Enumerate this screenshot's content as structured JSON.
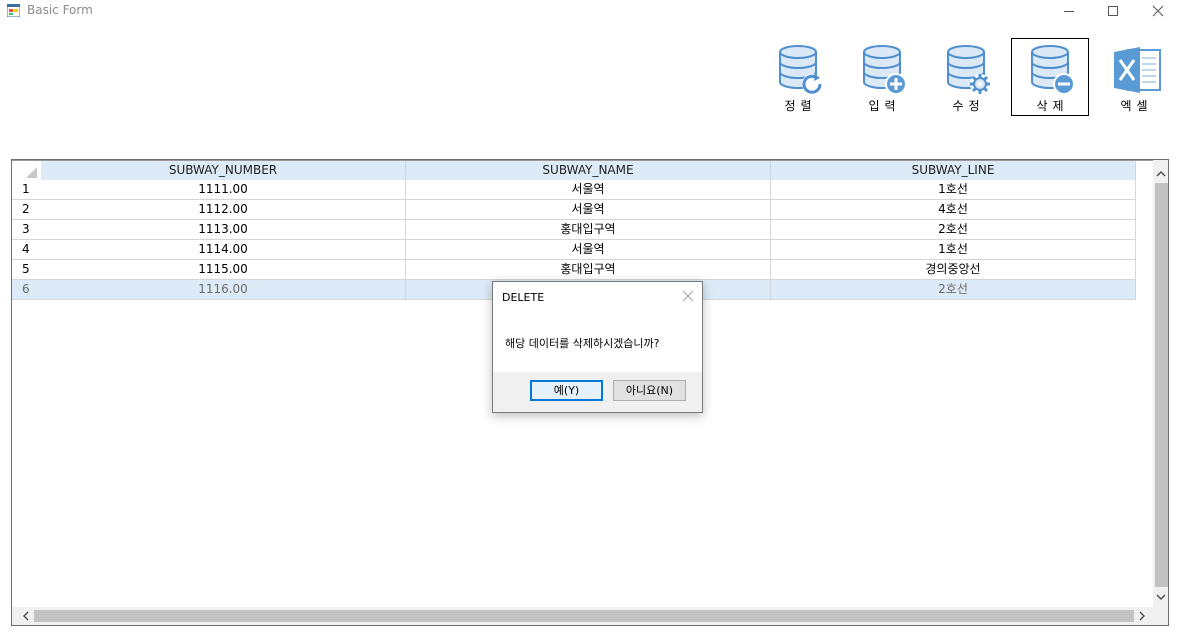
{
  "window": {
    "title": "Basic Form",
    "icon": "form-app-icon",
    "controls": [
      "minimize-icon",
      "maximize-icon",
      "close-icon"
    ]
  },
  "toolbar": {
    "buttons": [
      {
        "label": "정렬",
        "icon": "database-refresh-icon",
        "active": false
      },
      {
        "label": "입력",
        "icon": "database-add-icon",
        "active": false
      },
      {
        "label": "수정",
        "icon": "database-gear-icon",
        "active": false
      },
      {
        "label": "삭제",
        "icon": "database-remove-icon",
        "active": true
      },
      {
        "label": "엑셀",
        "icon": "excel-icon",
        "active": false
      }
    ]
  },
  "grid": {
    "columns": [
      "SUBWAY_NUMBER",
      "SUBWAY_NAME",
      "SUBWAY_LINE"
    ],
    "rows": [
      {
        "num": "1",
        "cells": [
          "1111.00",
          "서울역",
          "1호선"
        ]
      },
      {
        "num": "2",
        "cells": [
          "1112.00",
          "서울역",
          "4호선"
        ]
      },
      {
        "num": "3",
        "cells": [
          "1113.00",
          "홍대입구역",
          "2호선"
        ]
      },
      {
        "num": "4",
        "cells": [
          "1114.00",
          "서울역",
          "1호선"
        ]
      },
      {
        "num": "5",
        "cells": [
          "1115.00",
          "홍대입구역",
          "경의중앙선"
        ]
      },
      {
        "num": "6",
        "cells": [
          "1116.00",
          "",
          "2호선"
        ]
      }
    ],
    "selected_row": 6
  },
  "dialog": {
    "title": "DELETE",
    "message": "해당 데이터를 삭제하시겠습니까?",
    "yes_label": "예(Y)",
    "no_label": "아니요(N)"
  },
  "colors": {
    "header_bg": "#dcebf7",
    "selected_bg": "#dcebf7",
    "icon_blue": "#5b9bd5",
    "focus_border": "#0078d7"
  }
}
